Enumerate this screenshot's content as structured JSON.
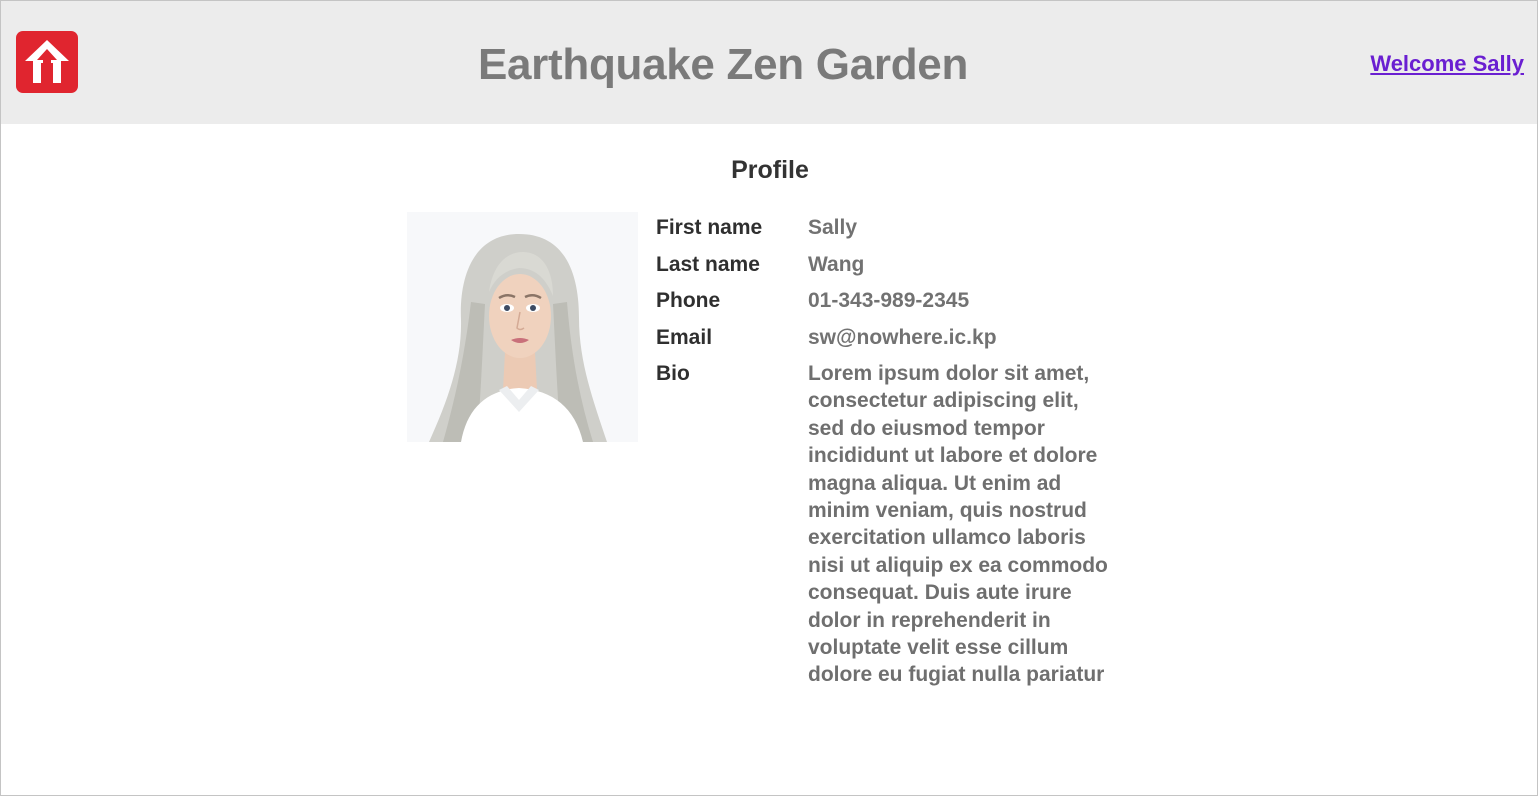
{
  "header": {
    "logo_icon": "house-arrow-icon",
    "title": "Earthquake Zen Garden",
    "welcome_link": "Welcome Sally",
    "colors": {
      "bar_background": "#ececec",
      "logo_red": "#e0252f",
      "title_gray": "#7a7a7a",
      "link_purple": "#6a1fd1"
    }
  },
  "main": {
    "heading": "Profile",
    "avatar_icon": "profile-photo",
    "fields": [
      {
        "label": "First name",
        "value": "Sally"
      },
      {
        "label": "Last name",
        "value": "Wang"
      },
      {
        "label": "Phone",
        "value": "01-343-989-2345"
      },
      {
        "label": "Email",
        "value": "sw@nowhere.ic.kp"
      },
      {
        "label": "Bio",
        "value": "Lorem ipsum dolor sit amet, consectetur adipiscing elit, sed do eiusmod tempor incididunt ut labore et dolore magna aliqua. Ut enim ad minim veniam, quis nostrud exercitation ullamco laboris nisi ut aliquip ex ea commodo consequat. Duis aute irure dolor in reprehenderit in voluptate velit esse cillum dolore eu fugiat nulla pariatur"
      }
    ]
  }
}
